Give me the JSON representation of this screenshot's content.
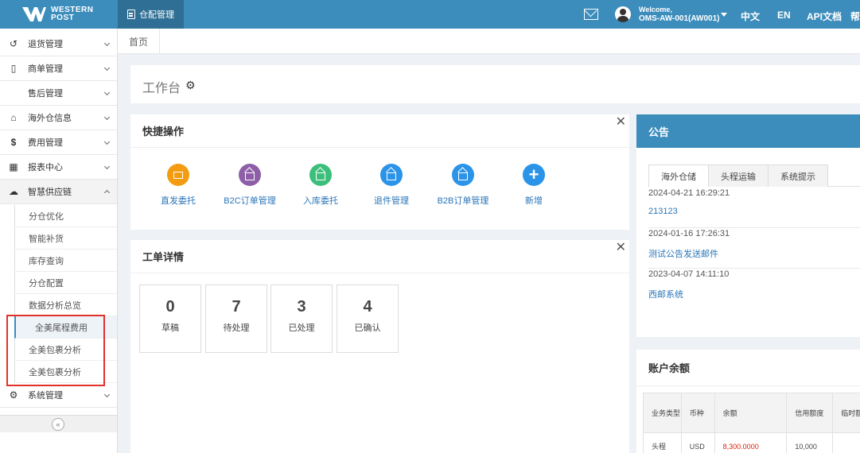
{
  "header": {
    "logo_line1": "WESTERN",
    "logo_line2": "POST",
    "module_tab": "仓配管理",
    "welcome": "Welcome,",
    "user": "OMS-AW-001(AW001)",
    "links": [
      "中文",
      "EN",
      "API文档",
      "帮"
    ]
  },
  "sidebar": {
    "items": [
      {
        "label": "退货管理",
        "icon": "refresh-icon"
      },
      {
        "label": "商单管理",
        "icon": "document-icon"
      },
      {
        "label": "售后管理",
        "icon": ""
      },
      {
        "label": "海外仓信息",
        "icon": "home-icon"
      },
      {
        "label": "费用管理",
        "icon": "dollar-icon"
      },
      {
        "label": "报表中心",
        "icon": "table-icon"
      },
      {
        "label": "智慧供应链",
        "icon": "cloud-icon"
      }
    ],
    "sub_items": [
      "分仓优化",
      "智能补货",
      "库存查询",
      "分仓配置",
      "数据分析总览",
      "全美尾程费用",
      "全美包裹分析",
      "全美包裹分析"
    ],
    "last_item": {
      "label": "系统管理",
      "icon": "gear-icon"
    },
    "collapse_glyph": "«"
  },
  "breadcrumb": {
    "home": "首页"
  },
  "workbench": {
    "title": "工作台"
  },
  "quick_ops": {
    "title": "快捷操作",
    "items": [
      {
        "label": "直发委托",
        "color": "#f39c12"
      },
      {
        "label": "B2C订单管理",
        "color": "#8e5fa8"
      },
      {
        "label": "入库委托",
        "color": "#3cbf7a"
      },
      {
        "label": "退件管理",
        "color": "#2b93e8"
      },
      {
        "label": "B2B订单管理",
        "color": "#2b93e8"
      },
      {
        "label": "新增",
        "color": "#2b93e8"
      }
    ]
  },
  "work_orders": {
    "title": "工单详情",
    "stats": [
      {
        "value": "0",
        "label": "草稿"
      },
      {
        "value": "7",
        "label": "待处理"
      },
      {
        "value": "3",
        "label": "已处理"
      },
      {
        "value": "4",
        "label": "已确认"
      }
    ]
  },
  "notice": {
    "title": "公告",
    "tabs": [
      "海外仓储",
      "头程运输",
      "系统提示"
    ],
    "items": [
      {
        "date": "2024-04-21 16:29:21",
        "title": "213123"
      },
      {
        "date": "2024-01-16 17:26:31",
        "title": "测试公告发送邮件"
      },
      {
        "date": "2023-04-07 14:11:10",
        "title": "西邮系统"
      }
    ]
  },
  "balance": {
    "title": "账户余额",
    "headers": [
      "业务类型",
      "币种",
      "余额",
      "信用额度",
      "临时额度"
    ],
    "rows": [
      [
        "头程",
        "USD",
        "8,300.0000",
        "10,000",
        ""
      ]
    ]
  },
  "close_glyph": "✕"
}
